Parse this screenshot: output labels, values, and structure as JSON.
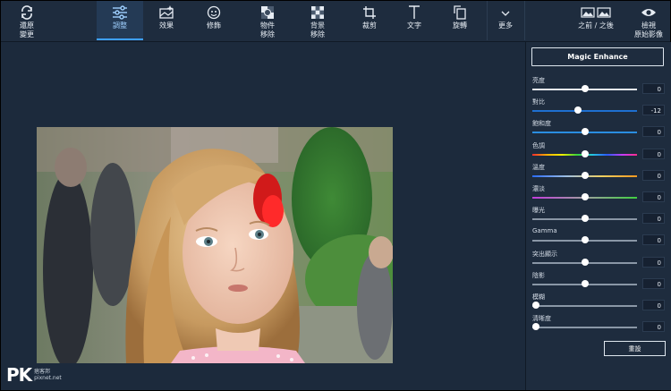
{
  "toolbar": {
    "undo": "還原\n變更",
    "adjust": "調整",
    "effects": "效果",
    "retouch": "修飾",
    "object_remove": "物件\n移除",
    "bg_remove": "背景\n移除",
    "crop": "裁剪",
    "text": "文字",
    "rotate": "旋轉",
    "more": "更多",
    "before_after": "之前 / 之後",
    "view_original": "檢視\n原始影像"
  },
  "panel": {
    "magic_label": "Magic Enhance",
    "reset_label": "重設",
    "adjustments": [
      {
        "name": "亮度",
        "value": "0",
        "level": 0.5,
        "track": "#e8eef4"
      },
      {
        "name": "對比",
        "value": "-12",
        "level": 0.44,
        "track": "#1e6fd0"
      },
      {
        "name": "飽和度",
        "value": "0",
        "level": 0.5,
        "track": "#2a8ee0"
      },
      {
        "name": "色調",
        "value": "0",
        "level": 0.5,
        "track": "rainbow"
      },
      {
        "name": "溫度",
        "value": "0",
        "level": 0.5,
        "track": "temp"
      },
      {
        "name": "濃淡",
        "value": "0",
        "level": 0.5,
        "track": "tint"
      },
      {
        "name": "曝光",
        "value": "0",
        "level": 0.5,
        "track": "#8a97a6"
      },
      {
        "name": "Gamma",
        "value": "0",
        "level": 0.5,
        "track": "#8a97a6"
      },
      {
        "name": "突出顯示",
        "value": "0",
        "level": 0.5,
        "track": "#8a97a6"
      },
      {
        "name": "陰影",
        "value": "0",
        "level": 0.5,
        "track": "#8a97a6"
      },
      {
        "name": "模糊",
        "value": "0",
        "level": 0.0,
        "track": "#8a97a6"
      },
      {
        "name": "清晰度",
        "value": "0",
        "level": 0.0,
        "track": "#8a97a6"
      }
    ]
  },
  "watermark": {
    "logo": "PK",
    "line1": "痞客邦",
    "line2": "pixnet.net"
  },
  "colors": {
    "accent": "#3ea0ff",
    "background": "#1e2c3e"
  }
}
